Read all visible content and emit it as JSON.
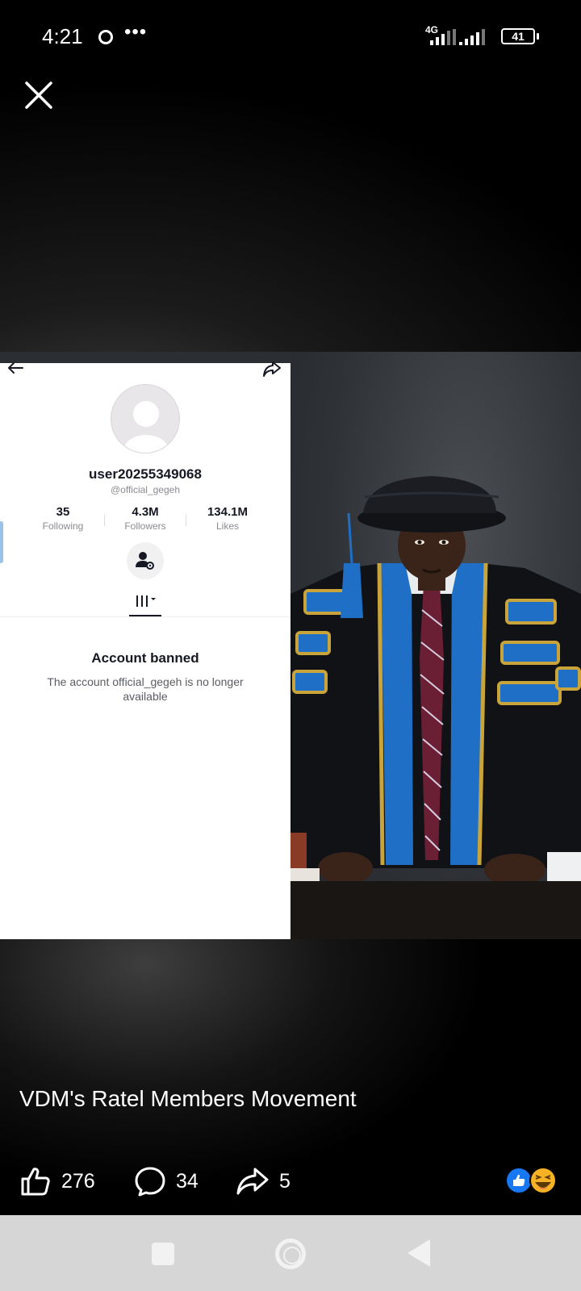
{
  "status_bar": {
    "time": "4:21",
    "network_type": "4G",
    "battery_level": "41"
  },
  "photo": {
    "profile_screenshot": {
      "username": "user20255349068",
      "handle": "@official_gegeh",
      "stats": [
        {
          "value": "35",
          "label": "Following"
        },
        {
          "value": "4.3M",
          "label": "Followers"
        },
        {
          "value": "134.1M",
          "label": "Likes"
        }
      ],
      "banned_title": "Account banned",
      "banned_message": "The account official_gegeh is no longer available"
    }
  },
  "post": {
    "caption": "VDM's Ratel Members Movement",
    "likes": "276",
    "comments": "34",
    "shares": "5"
  },
  "colors": {
    "like_blue": "#1877f2",
    "haha_yellow": "#f7b125",
    "nav_bar": "#d6d6d6"
  }
}
